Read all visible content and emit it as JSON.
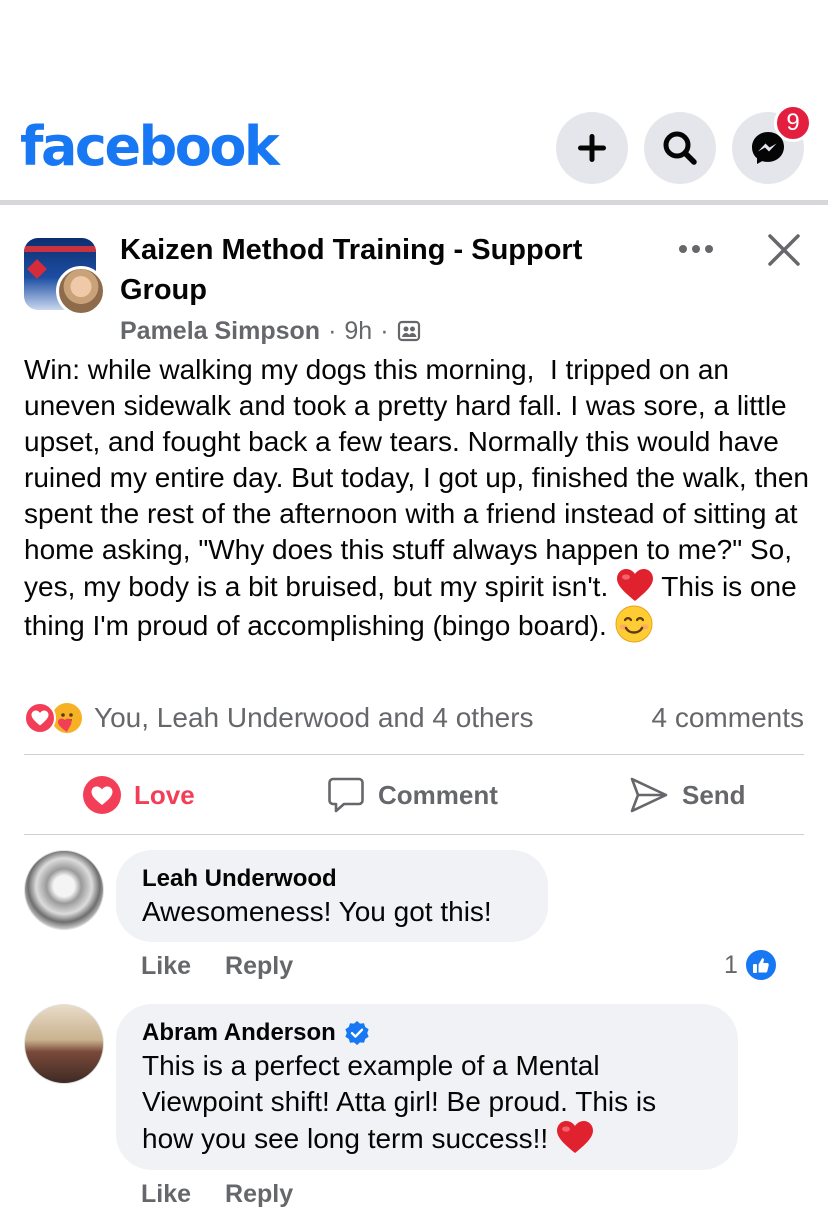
{
  "header": {
    "logo_text": "facebook",
    "messenger_badge": "9"
  },
  "post": {
    "group_name": "Kaizen Method Training - Support Group",
    "author": "Pamela Simpson",
    "time": "9h",
    "separator": "·",
    "text_main": "Win: while walking my dogs this morning,  I tripped on an uneven sidewalk and took a pretty hard fall. I was sore, a little upset, and fought back a few tears. Normally this would have ruined my entire day. But today, I got up, finished the walk, then spent the rest of the afternoon with a friend instead of sitting at home asking, \"Why does this stuff always happen to me?\" So, yes, my body is a bit bruised, but my spirit isn't. ",
    "text_after_heart": " This is one thing I'm proud of accomplishing (bingo board). ",
    "reactors": "You, Leah Underwood and 4 others",
    "comments_count": "4 comments"
  },
  "actions": {
    "love": "Love",
    "comment": "Comment",
    "send": "Send"
  },
  "comments": [
    {
      "name": "Leah Underwood",
      "text": "Awesomeness! You got this!",
      "like_label": "Like",
      "reply_label": "Reply",
      "like_count": "1"
    },
    {
      "name": "Abram Anderson",
      "text": "This is a perfect example of a Mental Viewpoint shift! Atta girl! Be proud. This is how you see long term success!! ",
      "like_label": "Like",
      "reply_label": "Reply"
    }
  ],
  "colors": {
    "brand": "#1877f2",
    "love": "#f33e58",
    "badge": "#e41e3f",
    "muted": "#65676b",
    "bubble": "#f0f2f5"
  },
  "icons": {
    "add": "plus-icon",
    "search": "search-icon",
    "messenger": "messenger-icon",
    "more": "more-icon",
    "close": "close-icon",
    "audience": "group-members-icon",
    "love_reaction": "love-reaction-icon",
    "care_reaction": "care-reaction-icon",
    "comment": "comment-icon",
    "send": "send-icon",
    "verified": "verified-badge-icon",
    "like": "like-icon"
  }
}
